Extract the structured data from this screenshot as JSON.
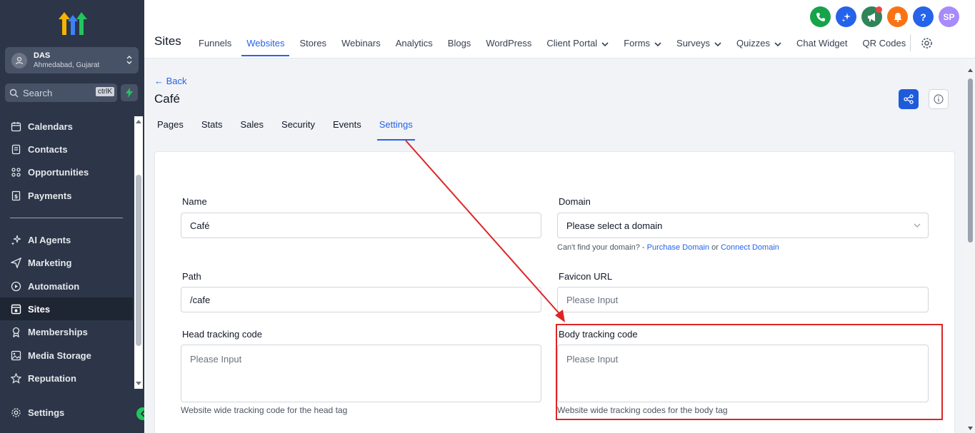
{
  "sidebar": {
    "account": {
      "name": "DAS",
      "location": "Ahmedabad, Gujarat"
    },
    "search": {
      "label": "Search",
      "shortcut": "ctrlK"
    },
    "items_top": [
      {
        "label": "Calendars",
        "icon": "calendar-icon"
      },
      {
        "label": "Contacts",
        "icon": "contacts-icon"
      },
      {
        "label": "Opportunities",
        "icon": "opportunities-icon"
      },
      {
        "label": "Payments",
        "icon": "payments-icon"
      }
    ],
    "items_bottom": [
      {
        "label": "AI Agents",
        "icon": "sparkle-icon"
      },
      {
        "label": "Marketing",
        "icon": "send-icon"
      },
      {
        "label": "Automation",
        "icon": "automation-icon"
      },
      {
        "label": "Sites",
        "icon": "sites-icon",
        "active": true
      },
      {
        "label": "Memberships",
        "icon": "award-icon"
      },
      {
        "label": "Media Storage",
        "icon": "image-icon"
      },
      {
        "label": "Reputation",
        "icon": "star-icon"
      }
    ],
    "settings": {
      "label": "Settings",
      "icon": "gear-icon"
    }
  },
  "topbar": {
    "title": "Sites",
    "nav": [
      {
        "label": "Funnels"
      },
      {
        "label": "Websites",
        "active": true
      },
      {
        "label": "Stores"
      },
      {
        "label": "Webinars"
      },
      {
        "label": "Analytics"
      },
      {
        "label": "Blogs"
      },
      {
        "label": "WordPress"
      },
      {
        "label": "Client Portal",
        "dropdown": true
      },
      {
        "label": "Forms",
        "dropdown": true
      },
      {
        "label": "Surveys",
        "dropdown": true
      },
      {
        "label": "Quizzes",
        "dropdown": true
      },
      {
        "label": "Chat Widget"
      },
      {
        "label": "QR Codes"
      }
    ],
    "icons": [
      {
        "name": "phone-icon",
        "color": "#16a34a"
      },
      {
        "name": "ai-sparkle-icon",
        "color": "#2563eb"
      },
      {
        "name": "megaphone-icon",
        "color": "#15803d"
      },
      {
        "name": "bell-icon",
        "color": "#f97316"
      },
      {
        "name": "help-icon",
        "color": "#2563eb"
      }
    ],
    "avatar": "SP"
  },
  "page": {
    "back": "← Back",
    "title": "Café",
    "tabs": [
      "Pages",
      "Stats",
      "Sales",
      "Security",
      "Events",
      "Settings"
    ],
    "active_tab": "Settings"
  },
  "form": {
    "name": {
      "label": "Name",
      "value": "Café"
    },
    "domain": {
      "label": "Domain",
      "placeholder": "Please select a domain",
      "hint_prefix": "Can't find your domain? - ",
      "purchase": "Purchase Domain",
      "or": " or ",
      "connect": "Connect Domain"
    },
    "path": {
      "label": "Path",
      "value": "/cafe"
    },
    "favicon": {
      "label": "Favicon URL",
      "placeholder": "Please Input"
    },
    "head": {
      "label": "Head tracking code",
      "placeholder": "Please Input",
      "hint": "Website wide tracking code for the head tag"
    },
    "body": {
      "label": "Body tracking code",
      "placeholder": "Please Input",
      "hint": "Website wide tracking codes for the body tag"
    }
  },
  "colors": {
    "accent": "#2563eb",
    "sidebar": "#2c3648",
    "annotation": "#dc2626"
  }
}
